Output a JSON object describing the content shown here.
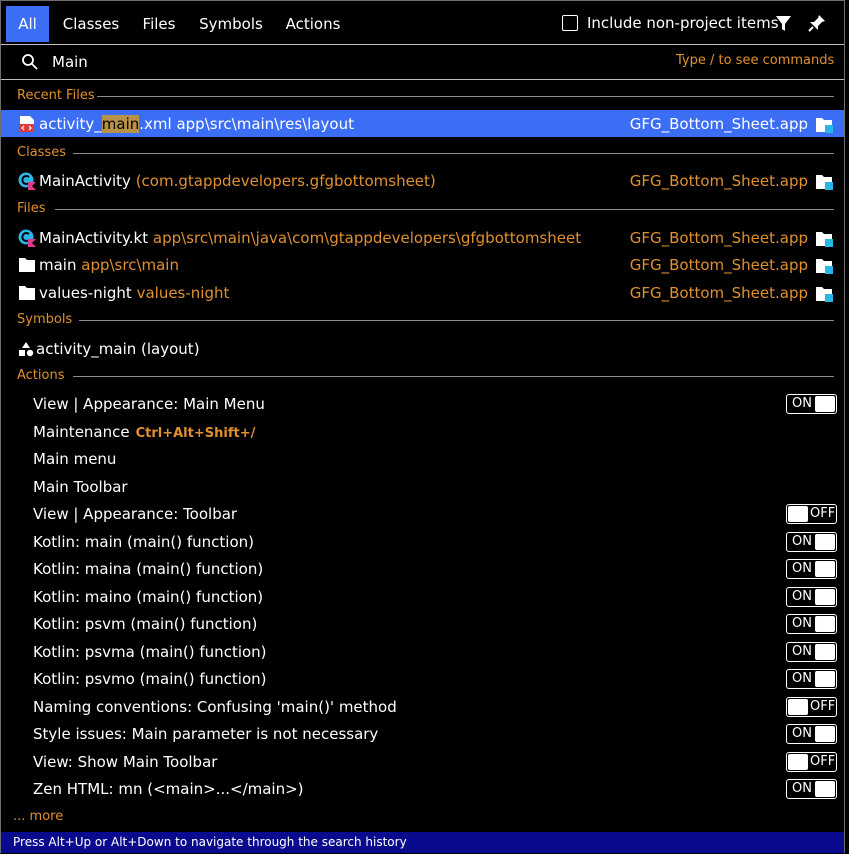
{
  "tabs": [
    "All",
    "Classes",
    "Files",
    "Symbols",
    "Actions"
  ],
  "include_non_project_label": "Include non-project items",
  "search": {
    "value": "Main",
    "hint": "Type / to see commands"
  },
  "sections": {
    "recent_files": "Recent Files",
    "classes": "Classes",
    "files": "Files",
    "symbols": "Symbols",
    "actions": "Actions"
  },
  "recent_file": {
    "name_pre": "activity_",
    "name_hl": "main",
    "name_post": ".xml app\\src\\main\\res\\layout",
    "project": "GFG_Bottom_Sheet.app"
  },
  "class_item": {
    "name": "MainActivity",
    "pkg": "(com.gtappdevelopers.gfgbottomsheet)",
    "project": "GFG_Bottom_Sheet.app"
  },
  "file_items": [
    {
      "name": "MainActivity.kt",
      "path": "app\\src\\main\\java\\com\\gtappdevelopers\\gfgbottomsheet",
      "project": "GFG_Bottom_Sheet.app"
    },
    {
      "name": "main",
      "path": "app\\src\\main",
      "project": "GFG_Bottom_Sheet.app"
    },
    {
      "name": "values-night",
      "path": "values-night",
      "project": "GFG_Bottom_Sheet.app"
    }
  ],
  "symbol_item": {
    "name": "activity_main (layout)"
  },
  "actions": [
    {
      "label": "View | Appearance: Main Menu",
      "toggle": "ON"
    },
    {
      "label": "Maintenance",
      "shortcut": "Ctrl+Alt+Shift+/"
    },
    {
      "label": "Main menu"
    },
    {
      "label": "Main Toolbar"
    },
    {
      "label": "View | Appearance: Toolbar",
      "toggle": "OFF"
    },
    {
      "label": "Kotlin: main (main() function)",
      "toggle": "ON"
    },
    {
      "label": "Kotlin: maina (main() function)",
      "toggle": "ON"
    },
    {
      "label": "Kotlin: maino (main() function)",
      "toggle": "ON"
    },
    {
      "label": "Kotlin: psvm (main() function)",
      "toggle": "ON"
    },
    {
      "label": "Kotlin: psvma (main() function)",
      "toggle": "ON"
    },
    {
      "label": "Kotlin: psvmo (main() function)",
      "toggle": "ON"
    },
    {
      "label": "Naming conventions: Confusing 'main()' method",
      "toggle": "OFF"
    },
    {
      "label": "Style issues: Main parameter is not necessary",
      "toggle": "ON"
    },
    {
      "label": "View: Show Main Toolbar",
      "toggle": "OFF"
    },
    {
      "label": "Zen HTML: mn (<main>...</main>)",
      "toggle": "ON"
    }
  ],
  "more_label": "... more",
  "status": "Press Alt+Up or Alt+Down to navigate through the search history",
  "colors": {
    "accent": "#3b6ef5",
    "orange": "#e0902f",
    "status_bg": "#0a0a8e"
  },
  "icons": [
    "search-icon",
    "filter-icon",
    "pin-icon",
    "xml-layout-file-icon",
    "kotlin-class-icon",
    "kotlin-file-icon",
    "folder-icon",
    "symbol-icon",
    "module-icon"
  ]
}
